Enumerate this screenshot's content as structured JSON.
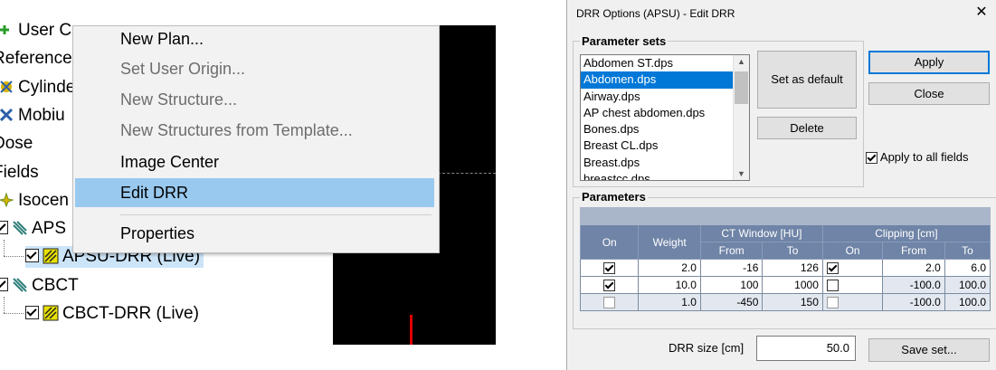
{
  "tree": {
    "items": [
      {
        "label": "User C"
      },
      {
        "label": "Reference"
      },
      {
        "label": "Cylinde"
      },
      {
        "label": "Mobiu"
      },
      {
        "label": "Dose"
      },
      {
        "label": "Fields"
      },
      {
        "label": "Isocen"
      },
      {
        "label": "APS"
      },
      {
        "label": "APSU-DRR (Live)"
      },
      {
        "label": "CBCT"
      },
      {
        "label": "CBCT-DRR (Live)"
      }
    ]
  },
  "context_menu": {
    "items": [
      {
        "label": "New Plan...",
        "enabled": true
      },
      {
        "label": "Set User Origin...",
        "enabled": false
      },
      {
        "label": "New Structure...",
        "enabled": false
      },
      {
        "label": "New Structures from Template...",
        "enabled": false
      },
      {
        "label": "Image Center",
        "enabled": true
      },
      {
        "label": "Edit DRR",
        "enabled": true,
        "highlighted": true
      },
      {
        "label": "Properties",
        "enabled": true
      }
    ]
  },
  "dialog": {
    "title": "DRR Options (APSU) - Edit DRR",
    "close_glyph": "✕",
    "parameter_sets": {
      "label": "Parameter sets",
      "items": [
        "Abdomen ST.dps",
        "Abdomen.dps",
        "Airway.dps",
        "AP chest abdomen.dps",
        "Bones.dps",
        "Breast CL.dps",
        "Breast.dps",
        "breastcc.dps"
      ],
      "selected": "Abdomen.dps"
    },
    "buttons": {
      "set_default": "Set as default",
      "delete": "Delete",
      "apply": "Apply",
      "close": "Close",
      "save_set": "Save set..."
    },
    "apply_all": {
      "label": "Apply to all fields",
      "checked": true
    },
    "parameters": {
      "label": "Parameters",
      "headers": {
        "on": "On",
        "weight": "Weight",
        "ct_window": "CT Window [HU]",
        "clipping": "Clipping [cm]",
        "from": "From",
        "to": "To",
        "clip_on": "On",
        "clip_from": "From",
        "clip_to": "To"
      },
      "rows": [
        {
          "on": true,
          "weight": "2.0",
          "from": "-16",
          "to": "126",
          "clip_on": true,
          "clip_from": "2.0",
          "clip_to": "6.0"
        },
        {
          "on": true,
          "weight": "10.0",
          "from": "100",
          "to": "1000",
          "clip_on": false,
          "clip_from": "-100.0",
          "clip_to": "100.0"
        },
        {
          "on": false,
          "weight": "1.0",
          "from": "-450",
          "to": "150",
          "clip_on": false,
          "clip_from": "-100.0",
          "clip_to": "100.0"
        }
      ]
    },
    "drr_size": {
      "label": "DRR size [cm]",
      "value": "50.0"
    }
  },
  "colors": {
    "menu_highlight": "#99c9ef",
    "table_header": "#6f84a6",
    "selection": "#0078d7",
    "marker_red": "#e00000"
  }
}
